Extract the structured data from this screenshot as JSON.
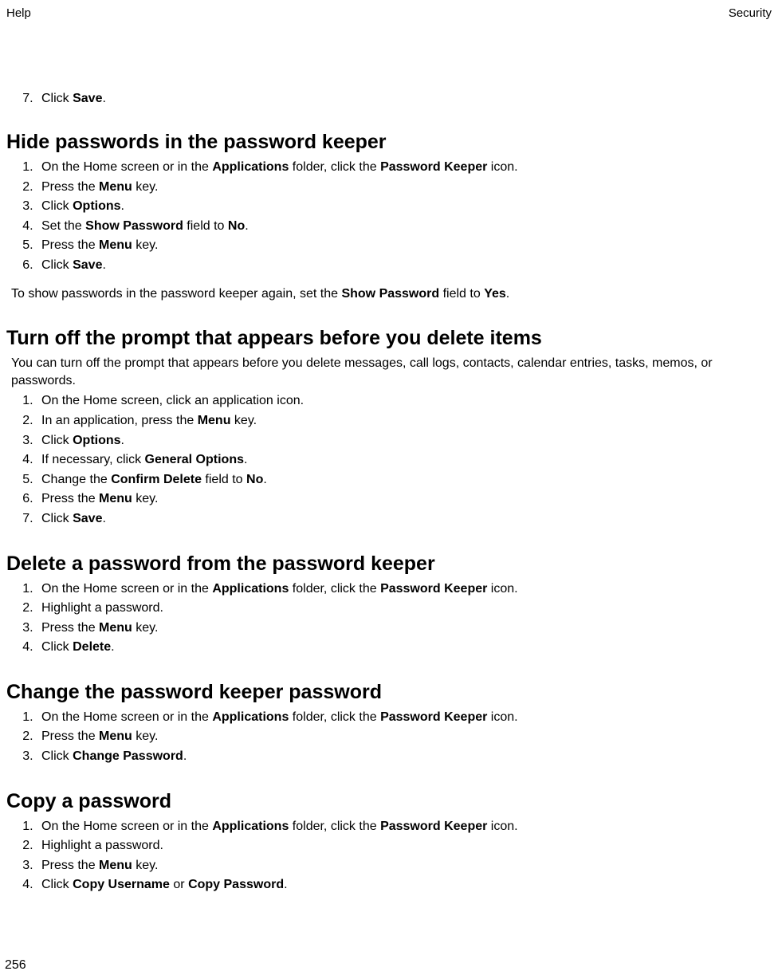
{
  "header": {
    "left": "Help",
    "right": "Security"
  },
  "continued": {
    "start": 7,
    "item": {
      "pre": "Click ",
      "bold": "Save",
      "post": "."
    }
  },
  "sections": [
    {
      "heading": "Hide passwords in the password keeper",
      "steps": [
        [
          {
            "t": "On the Home screen or in the "
          },
          {
            "b": "Applications"
          },
          {
            "t": " folder, click the "
          },
          {
            "b": "Password Keeper"
          },
          {
            "t": " icon."
          }
        ],
        [
          {
            "t": "Press the "
          },
          {
            "b": "Menu"
          },
          {
            "t": " key."
          }
        ],
        [
          {
            "t": "Click "
          },
          {
            "b": "Options"
          },
          {
            "t": "."
          }
        ],
        [
          {
            "t": "Set the "
          },
          {
            "b": "Show Password"
          },
          {
            "t": " field to "
          },
          {
            "b": "No"
          },
          {
            "t": "."
          }
        ],
        [
          {
            "t": "Press the "
          },
          {
            "b": "Menu"
          },
          {
            "t": " key."
          }
        ],
        [
          {
            "t": "Click "
          },
          {
            "b": "Save"
          },
          {
            "t": "."
          }
        ]
      ],
      "after": [
        {
          "t": "To show passwords in the password keeper again, set the "
        },
        {
          "b": "Show Password"
        },
        {
          "t": " field to "
        },
        {
          "b": "Yes"
        },
        {
          "t": "."
        }
      ]
    },
    {
      "heading": "Turn off the prompt that appears before you delete items",
      "intro": [
        {
          "t": "You can turn off the prompt that appears before you delete messages, call logs, contacts, calendar entries, tasks, memos, or passwords."
        }
      ],
      "steps": [
        [
          {
            "t": "On the Home screen, click an application icon."
          }
        ],
        [
          {
            "t": "In an application, press the "
          },
          {
            "b": "Menu"
          },
          {
            "t": " key."
          }
        ],
        [
          {
            "t": "Click "
          },
          {
            "b": "Options"
          },
          {
            "t": "."
          }
        ],
        [
          {
            "t": "If necessary, click "
          },
          {
            "b": "General Options"
          },
          {
            "t": "."
          }
        ],
        [
          {
            "t": "Change the "
          },
          {
            "b": "Confirm Delete"
          },
          {
            "t": " field to "
          },
          {
            "b": "No"
          },
          {
            "t": "."
          }
        ],
        [
          {
            "t": "Press the "
          },
          {
            "b": "Menu"
          },
          {
            "t": " key."
          }
        ],
        [
          {
            "t": "Click "
          },
          {
            "b": "Save"
          },
          {
            "t": "."
          }
        ]
      ]
    },
    {
      "heading": "Delete a password from the password keeper",
      "steps": [
        [
          {
            "t": "On the Home screen or in the "
          },
          {
            "b": "Applications"
          },
          {
            "t": " folder, click the "
          },
          {
            "b": "Password Keeper"
          },
          {
            "t": " icon."
          }
        ],
        [
          {
            "t": "Highlight a password."
          }
        ],
        [
          {
            "t": "Press the "
          },
          {
            "b": "Menu"
          },
          {
            "t": " key."
          }
        ],
        [
          {
            "t": "Click "
          },
          {
            "b": "Delete"
          },
          {
            "t": "."
          }
        ]
      ]
    },
    {
      "heading": "Change the password keeper password",
      "steps": [
        [
          {
            "t": "On the Home screen or in the "
          },
          {
            "b": "Applications"
          },
          {
            "t": " folder, click the "
          },
          {
            "b": "Password Keeper"
          },
          {
            "t": " icon."
          }
        ],
        [
          {
            "t": "Press the "
          },
          {
            "b": "Menu"
          },
          {
            "t": " key."
          }
        ],
        [
          {
            "t": "Click "
          },
          {
            "b": "Change Password"
          },
          {
            "t": "."
          }
        ]
      ]
    },
    {
      "heading": "Copy a password",
      "steps": [
        [
          {
            "t": "On the Home screen or in the "
          },
          {
            "b": "Applications"
          },
          {
            "t": " folder, click the "
          },
          {
            "b": "Password Keeper"
          },
          {
            "t": " icon."
          }
        ],
        [
          {
            "t": "Highlight a password."
          }
        ],
        [
          {
            "t": "Press the "
          },
          {
            "b": "Menu"
          },
          {
            "t": " key."
          }
        ],
        [
          {
            "t": "Click "
          },
          {
            "b": "Copy Username"
          },
          {
            "t": " or "
          },
          {
            "b": "Copy Password"
          },
          {
            "t": "."
          }
        ]
      ]
    }
  ],
  "pageNumber": "256"
}
